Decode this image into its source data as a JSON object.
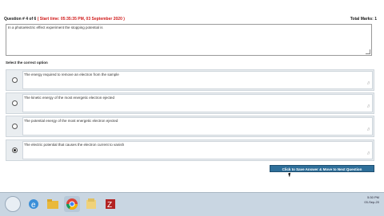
{
  "header": {
    "question_label": "Question # 4 of 6",
    "start_time": "( Start time: 05:35:35 PM, 03 September 2020 )",
    "total_marks": "Total Marks: 1"
  },
  "question": {
    "text": "In a photoelectric effect experiment the stopping potential is"
  },
  "select_label": "Select the correct option",
  "options": [
    {
      "text": "The energy required to remove an electron from the sample",
      "selected": false
    },
    {
      "text": "The kinetic energy of the most energetic electron ejected",
      "selected": false
    },
    {
      "text": "The potential energy of the most energetic electron ejected",
      "selected": false
    },
    {
      "text": "The electric potential that causes the electron current to vanish",
      "selected": true
    }
  ],
  "next_button": "Click to Save Answer & Move to Next Question",
  "taskbar": {
    "icons": [
      "start-orb",
      "internet-explorer-icon",
      "folder-icon",
      "chrome-icon",
      "files-icon",
      "filezilla-icon"
    ],
    "clock": "5:30 PM",
    "date": "03-Sep-20"
  }
}
